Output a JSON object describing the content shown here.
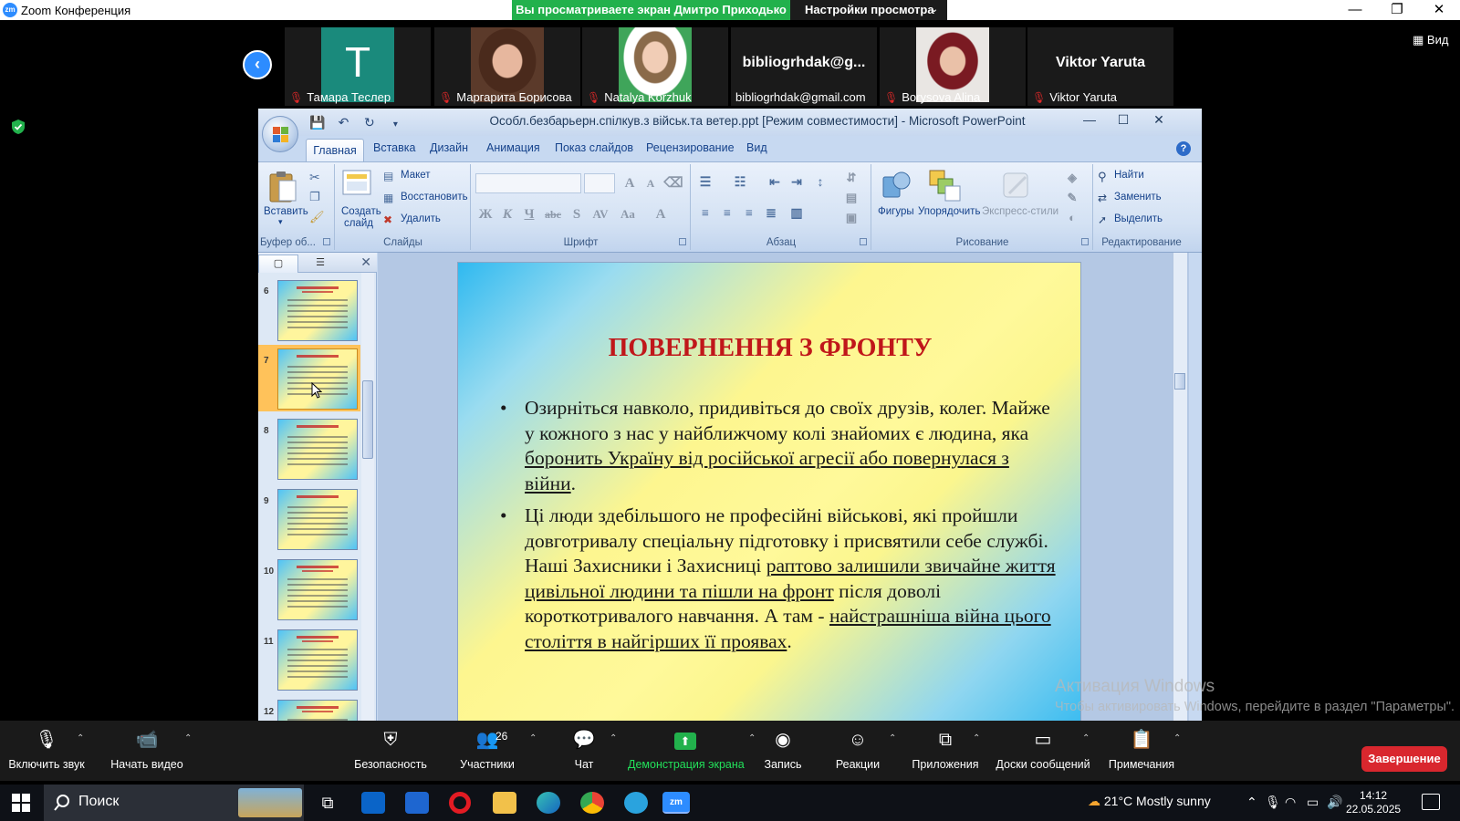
{
  "zoom": {
    "window_title": "Zoom Конференция",
    "share_banner": "Вы просматриваете экран Дмитро Приходько",
    "view_settings": "Настройки просмотра",
    "view_label": "Вид",
    "participants": [
      {
        "name": "Тамара Теслер",
        "initial": "T",
        "avatar_color": "#1a8a7c"
      },
      {
        "name": "Маргарита Борисова"
      },
      {
        "name": "Natalya Korzhuk"
      },
      {
        "name": "bibliogrhdak@gmail.com",
        "display": "bibliogrhdak@g..."
      },
      {
        "name": "Borysova Alina"
      },
      {
        "name": "Viktor Yaruta",
        "display": "Viktor Yaruta"
      }
    ],
    "toolbar": {
      "unmute": "Включить звук",
      "start_video": "Начать видео",
      "security": "Безопасность",
      "participants": "Участники",
      "participants_count": "26",
      "chat": "Чат",
      "share": "Демонстрация экрана",
      "record": "Запись",
      "reactions": "Реакции",
      "apps": "Приложения",
      "whiteboards": "Доски сообщений",
      "notes": "Примечания",
      "end": "Завершение"
    }
  },
  "ppt": {
    "title": "Особл.безбарьерн.спілкув.з військ.та ветер.ppt [Режим совместимости] - Microsoft PowerPoint",
    "tabs": [
      "Главная",
      "Вставка",
      "Дизайн",
      "Анимация",
      "Показ слайдов",
      "Рецензирование",
      "Вид"
    ],
    "ribbon": {
      "paste": "Вставить",
      "clipboard": "Буфер об...",
      "new_slide_1": "Создать",
      "new_slide_2": "слайд",
      "layout": "Макет",
      "reset": "Восстановить",
      "delete": "Удалить",
      "slides": "Слайды",
      "font": "Шрифт",
      "paragraph": "Абзац",
      "shapes": "Фигуры",
      "arrange": "Упорядочить",
      "quick_styles": "Экспресс-стили",
      "drawing": "Рисование",
      "find": "Найти",
      "replace": "Заменить",
      "select": "Выделить",
      "editing": "Редактирование"
    },
    "thumb_numbers": [
      "6",
      "7",
      "8",
      "9",
      "10",
      "11",
      "12"
    ],
    "slide": {
      "title": "ПОВЕРНЕННЯ З ФРОНТУ",
      "b1_a": "Озирніться навколо, придивіться до своїх друзів, колег. Майже у кожного з нас у найближчому колі знайомих є людина, яка ",
      "b1_u": "боронить Україну від російської агресії або повернулася з війни",
      "b1_c": ".",
      "b2_a": "Ці люди здебільшого не професійні військові, які пройшли довготривалу спеціальну підготовку і присвятили себе службі. Наші Захисники і Захисниці ",
      "b2_u1": "раптово залишили звичайне життя цивільної людини та пішли на фронт",
      "b2_b": " після доволі короткотривалого навчання. А там - ",
      "b2_u2": "найстрашніша війна цього століття в найгірших її проявах",
      "b2_c": "."
    }
  },
  "activation": {
    "title": "Активация Windows",
    "subtitle": "Чтобы активировать Windows, перейдите в раздел \"Параметры\"."
  },
  "taskbar": {
    "search": "Поиск",
    "weather": "21°C  Mostly sunny",
    "time": "14:12",
    "date": "22.05.2025"
  }
}
